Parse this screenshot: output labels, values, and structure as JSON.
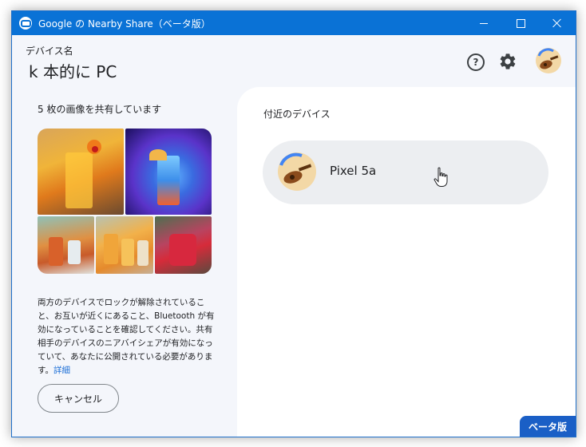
{
  "window": {
    "title": "Google の Nearby Share（ベータ版）",
    "minimize_icon": "minimize-icon",
    "maximize_icon": "maximize-icon",
    "close_icon": "close-icon",
    "accent_color": "#0a72d6"
  },
  "header": {
    "device_label": "デバイス名",
    "device_name": "k 本的に PC",
    "help_icon": "help-icon",
    "help_symbol": "?",
    "settings_icon": "gear-icon",
    "avatar_icon": "avatar"
  },
  "share": {
    "title": "5 枚の画像を共有しています",
    "images": [
      "image-1",
      "image-2",
      "image-3",
      "image-4",
      "image-5"
    ],
    "description": "両方のデバイスでロックが解除されていること、お互いが近くにあること、Bluetooth が有効になっていることを確認してください。共有相手のデバイスのニアバイシェアが有効になっていて、あなたに公開されている必要があります。",
    "details_link": "詳細",
    "cancel_label": "キャンセル"
  },
  "nearby": {
    "title": "付近のデバイス",
    "devices": [
      {
        "name": "Pixel 5a"
      }
    ]
  },
  "badge": {
    "label": "ベータ版",
    "color": "#1a5fc6"
  }
}
